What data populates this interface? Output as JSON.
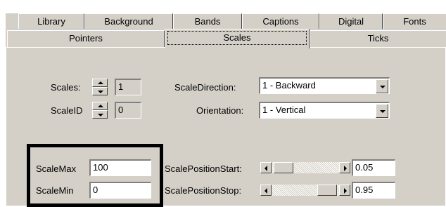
{
  "tabs_row1": [
    {
      "label": "Library"
    },
    {
      "label": "Background"
    },
    {
      "label": "Bands"
    },
    {
      "label": "Captions"
    },
    {
      "label": "Digital"
    },
    {
      "label": "Fonts"
    }
  ],
  "tabs_row2": [
    {
      "label": "Pointers"
    },
    {
      "label": "Scales",
      "selected": true
    },
    {
      "label": "Ticks"
    }
  ],
  "scales": {
    "label": "Scales:",
    "value": "1"
  },
  "scale_id": {
    "label": "ScaleID",
    "value": "0"
  },
  "scale_direction": {
    "label": "ScaleDirection:",
    "value": "1 - Backward"
  },
  "orientation": {
    "label": "Orientation:",
    "value": "1 - Vertical"
  },
  "scale_max": {
    "label": "ScaleMax",
    "value": "100"
  },
  "scale_min": {
    "label": "ScaleMin",
    "value": "0"
  },
  "scale_position_start": {
    "label": "ScalePositionStart:",
    "value": "0.05",
    "fraction": 0.05
  },
  "scale_position_stop": {
    "label": "ScalePositionStop:",
    "value": "0.95",
    "fraction": 0.95
  },
  "icons": {
    "spin": "spin-updown-icon",
    "dropdown": "chevron-down-icon",
    "scroll_left": "scroll-left-arrow-icon",
    "scroll_right": "scroll-right-arrow-icon"
  },
  "colors": {
    "face": "#d4d0c8",
    "highlight_border": "#000000"
  }
}
